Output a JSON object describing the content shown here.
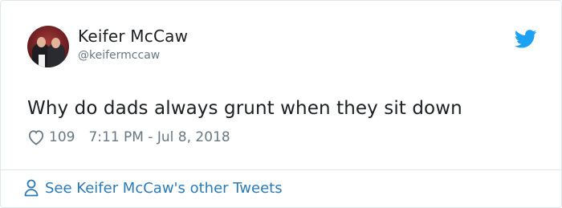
{
  "author": {
    "name": "Keifer McCaw",
    "handle": "@keifermccaw",
    "avatar": "profile-photo"
  },
  "tweet": {
    "text": "Why do dads always grunt when they sit down",
    "likes": "109",
    "timestamp": "7:11 PM - Jul 8, 2018"
  },
  "footer": {
    "link_label": "See Keifer McCaw's other Tweets"
  },
  "icons": {
    "brand": "twitter-bird-icon",
    "like": "heart-icon",
    "profile": "person-icon"
  },
  "colors": {
    "brand_blue": "#1da1f2",
    "link_blue": "#2b7bb9",
    "muted_text": "#697882",
    "border": "#e1e8ed"
  }
}
